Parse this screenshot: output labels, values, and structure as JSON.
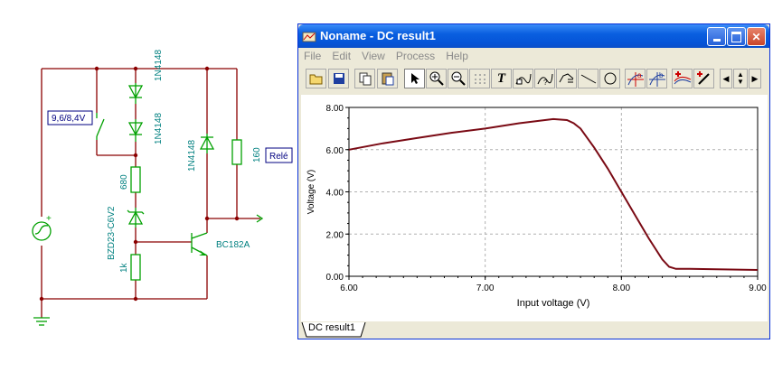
{
  "schematic": {
    "switch_label": "9,6/8,4V",
    "diode_top_label": "1N4148",
    "diode_mid_label": "1N4148",
    "diode_right_label": "1N4148",
    "resistor_680": "680",
    "zener_label": "BZD23-C6V2",
    "resistor_1k": "1k",
    "resistor_160": "160",
    "transistor_label": "BC182A",
    "output_label": "Relé",
    "source_plus": "+"
  },
  "window": {
    "title": "Noname - DC result1",
    "menu": [
      "File",
      "Edit",
      "View",
      "Process",
      "Help"
    ],
    "tab_label": "DC result1",
    "toolbar_icons": [
      "open-folder-icon",
      "save-icon",
      "copy-icon",
      "paste-icon",
      "pointer-icon",
      "zoom-in-icon",
      "zoom-out-icon",
      "grid-icon",
      "text-tool-icon",
      "curve-label-icon",
      "curve-label-2-icon",
      "cursor-icon",
      "line-tool-icon",
      "circle-tool-icon",
      "cursor-a-icon",
      "cursor-b-icon",
      "add-curve-icon",
      "probe-icon",
      "arrow-left-icon",
      "arrow-updown-icon",
      "arrow-right-icon"
    ]
  },
  "colors": {
    "curve": "#7a0a14",
    "titlebar": "#0554d7",
    "schematic_wire": "#8b0000",
    "schematic_part": "#00a000",
    "schematic_label": "#008080"
  },
  "chart_data": {
    "type": "line",
    "xlabel": "Input voltage (V)",
    "ylabel": "Voltage (V)",
    "xlim": [
      6.0,
      9.0
    ],
    "ylim": [
      0.0,
      8.0
    ],
    "xticks": [
      "6.00",
      "7.00",
      "8.00",
      "9.00"
    ],
    "yticks": [
      "0.00",
      "2.00",
      "4.00",
      "6.00",
      "8.00"
    ],
    "grid": true,
    "series": [
      {
        "x": [
          6.0,
          6.25,
          6.5,
          6.75,
          7.0,
          7.25,
          7.5,
          7.6,
          7.65,
          7.7,
          7.8,
          7.9,
          8.0,
          8.1,
          8.2,
          8.3,
          8.35,
          8.4,
          8.5,
          8.7,
          9.0
        ],
        "values": [
          6.0,
          6.3,
          6.55,
          6.8,
          7.0,
          7.25,
          7.45,
          7.4,
          7.25,
          7.0,
          6.1,
          5.1,
          4.0,
          2.9,
          1.8,
          0.8,
          0.45,
          0.35,
          0.35,
          0.33,
          0.3
        ]
      }
    ]
  }
}
